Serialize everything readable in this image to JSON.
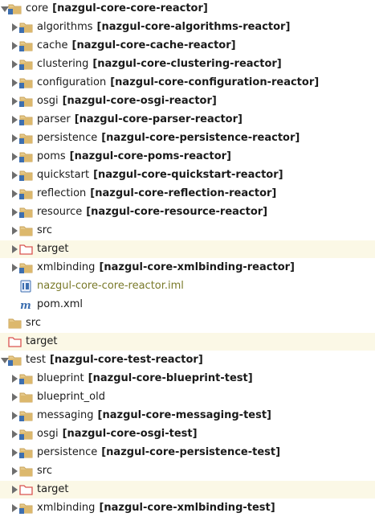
{
  "rows": [
    {
      "name": "core",
      "module": "[nazgul-core-core-reactor]",
      "level": 0,
      "arrow": "down",
      "icon": "module-folder-icon"
    },
    {
      "name": "algorithms",
      "module": "[nazgul-core-algorithms-reactor]",
      "level": 1,
      "arrow": "right",
      "icon": "module-folder-icon"
    },
    {
      "name": "cache",
      "module": "[nazgul-core-cache-reactor]",
      "level": 1,
      "arrow": "right",
      "icon": "module-folder-icon"
    },
    {
      "name": "clustering",
      "module": "[nazgul-core-clustering-reactor]",
      "level": 1,
      "arrow": "right",
      "icon": "module-folder-icon"
    },
    {
      "name": "configuration",
      "module": "[nazgul-core-configuration-reactor]",
      "level": 1,
      "arrow": "right",
      "icon": "module-folder-icon"
    },
    {
      "name": "osgi",
      "module": "[nazgul-core-osgi-reactor]",
      "level": 1,
      "arrow": "right",
      "icon": "module-folder-icon"
    },
    {
      "name": "parser",
      "module": "[nazgul-core-parser-reactor]",
      "level": 1,
      "arrow": "right",
      "icon": "module-folder-icon"
    },
    {
      "name": "persistence",
      "module": "[nazgul-core-persistence-reactor]",
      "level": 1,
      "arrow": "right",
      "icon": "module-folder-icon"
    },
    {
      "name": "poms",
      "module": "[nazgul-core-poms-reactor]",
      "level": 1,
      "arrow": "right",
      "icon": "module-folder-icon"
    },
    {
      "name": "quickstart",
      "module": "[nazgul-core-quickstart-reactor]",
      "level": 1,
      "arrow": "right",
      "icon": "module-folder-icon"
    },
    {
      "name": "reflection",
      "module": "[nazgul-core-reflection-reactor]",
      "level": 1,
      "arrow": "right",
      "icon": "module-folder-icon"
    },
    {
      "name": "resource",
      "module": "[nazgul-core-resource-reactor]",
      "level": 1,
      "arrow": "right",
      "icon": "module-folder-icon"
    },
    {
      "name": "src",
      "module": "",
      "level": 1,
      "arrow": "right",
      "icon": "folder-icon"
    },
    {
      "name": "target",
      "module": "",
      "level": 1,
      "arrow": "right",
      "icon": "excluded-folder-icon",
      "excluded": true
    },
    {
      "name": "xmlbinding",
      "module": "[nazgul-core-xmlbinding-reactor]",
      "level": 1,
      "arrow": "right",
      "icon": "module-folder-icon"
    },
    {
      "name": "nazgul-core-core-reactor.iml",
      "module": "",
      "level": 1,
      "arrow": "none",
      "icon": "iml-file-icon",
      "file": "iml"
    },
    {
      "name": "pom.xml",
      "module": "",
      "level": 1,
      "arrow": "none",
      "icon": "maven-file-icon",
      "file": "pom"
    },
    {
      "name": "src",
      "module": "",
      "level": 0,
      "arrow": "none",
      "icon": "folder-icon"
    },
    {
      "name": "target",
      "module": "",
      "level": 0,
      "arrow": "none",
      "icon": "excluded-folder-icon",
      "excluded": true
    },
    {
      "name": "test",
      "module": "[nazgul-core-test-reactor]",
      "level": 0,
      "arrow": "down",
      "icon": "module-folder-icon"
    },
    {
      "name": "blueprint",
      "module": "[nazgul-core-blueprint-test]",
      "level": 1,
      "arrow": "right",
      "icon": "module-folder-icon"
    },
    {
      "name": "blueprint_old",
      "module": "",
      "level": 1,
      "arrow": "right",
      "icon": "folder-icon"
    },
    {
      "name": "messaging",
      "module": "[nazgul-core-messaging-test]",
      "level": 1,
      "arrow": "right",
      "icon": "module-folder-icon"
    },
    {
      "name": "osgi",
      "module": "[nazgul-core-osgi-test]",
      "level": 1,
      "arrow": "right",
      "icon": "module-folder-icon"
    },
    {
      "name": "persistence",
      "module": "[nazgul-core-persistence-test]",
      "level": 1,
      "arrow": "right",
      "icon": "module-folder-icon"
    },
    {
      "name": "src",
      "module": "",
      "level": 1,
      "arrow": "right",
      "icon": "folder-icon"
    },
    {
      "name": "target",
      "module": "",
      "level": 1,
      "arrow": "right",
      "icon": "excluded-folder-icon",
      "excluded": true
    },
    {
      "name": "xmlbinding",
      "module": "[nazgul-core-xmlbinding-test]",
      "level": 1,
      "arrow": "right",
      "icon": "module-folder-icon"
    }
  ],
  "colors": {
    "folder": "#c9a35a",
    "module_badge": "#3d6fb0",
    "excluded_folder": "#d9534f",
    "excluded_row": "#fbf8e6",
    "iml_text": "#7a7a2a",
    "maven_icon": "#3d6fb0"
  }
}
